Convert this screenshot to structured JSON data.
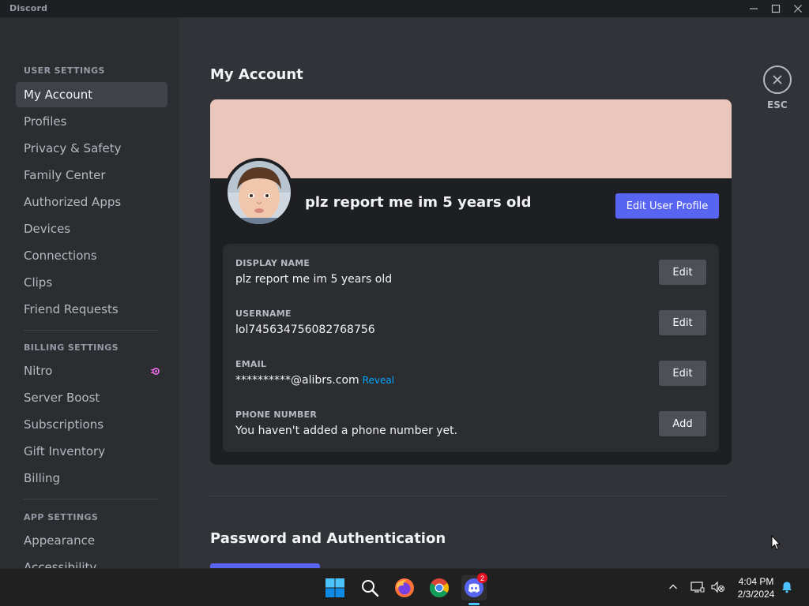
{
  "window": {
    "title": "Discord"
  },
  "sidebar": {
    "sections": [
      {
        "header": "USER SETTINGS",
        "items": [
          {
            "label": "My Account",
            "selected": true
          },
          {
            "label": "Profiles"
          },
          {
            "label": "Privacy & Safety"
          },
          {
            "label": "Family Center"
          },
          {
            "label": "Authorized Apps"
          },
          {
            "label": "Devices"
          },
          {
            "label": "Connections"
          },
          {
            "label": "Clips"
          },
          {
            "label": "Friend Requests"
          }
        ]
      },
      {
        "header": "BILLING SETTINGS",
        "items": [
          {
            "label": "Nitro",
            "icon": "nitro-icon"
          },
          {
            "label": "Server Boost"
          },
          {
            "label": "Subscriptions"
          },
          {
            "label": "Gift Inventory"
          },
          {
            "label": "Billing"
          }
        ]
      },
      {
        "header": "APP SETTINGS",
        "items": [
          {
            "label": "Appearance"
          },
          {
            "label": "Accessibility"
          }
        ]
      }
    ]
  },
  "main": {
    "title": "My Account",
    "close_label": "ESC",
    "profile": {
      "username": "plz report me im 5 years old",
      "edit_profile_label": "Edit User Profile",
      "banner_color": "#ebc6ba"
    },
    "fields": [
      {
        "label": "DISPLAY NAME",
        "value": "plz report me im 5 years old",
        "button": "Edit"
      },
      {
        "label": "USERNAME",
        "value": "lol745634756082768756",
        "button": "Edit"
      },
      {
        "label": "EMAIL",
        "value": "**********@alibrs.com",
        "link": "Reveal",
        "button": "Edit"
      },
      {
        "label": "PHONE NUMBER",
        "value": "You haven't added a phone number yet.",
        "button": "Add"
      }
    ],
    "section2_title": "Password and Authentication"
  },
  "taskbar": {
    "icons": [
      "windows-start-icon",
      "search-icon",
      "firefox-icon",
      "chrome-icon",
      "discord-icon"
    ],
    "discord_badge": "2",
    "time": "4:04 PM",
    "date": "2/3/2024"
  },
  "colors": {
    "accent": "#5865f2",
    "link": "#00a8fc",
    "sidebar_bg": "#2b2d31",
    "main_bg": "#313338"
  }
}
